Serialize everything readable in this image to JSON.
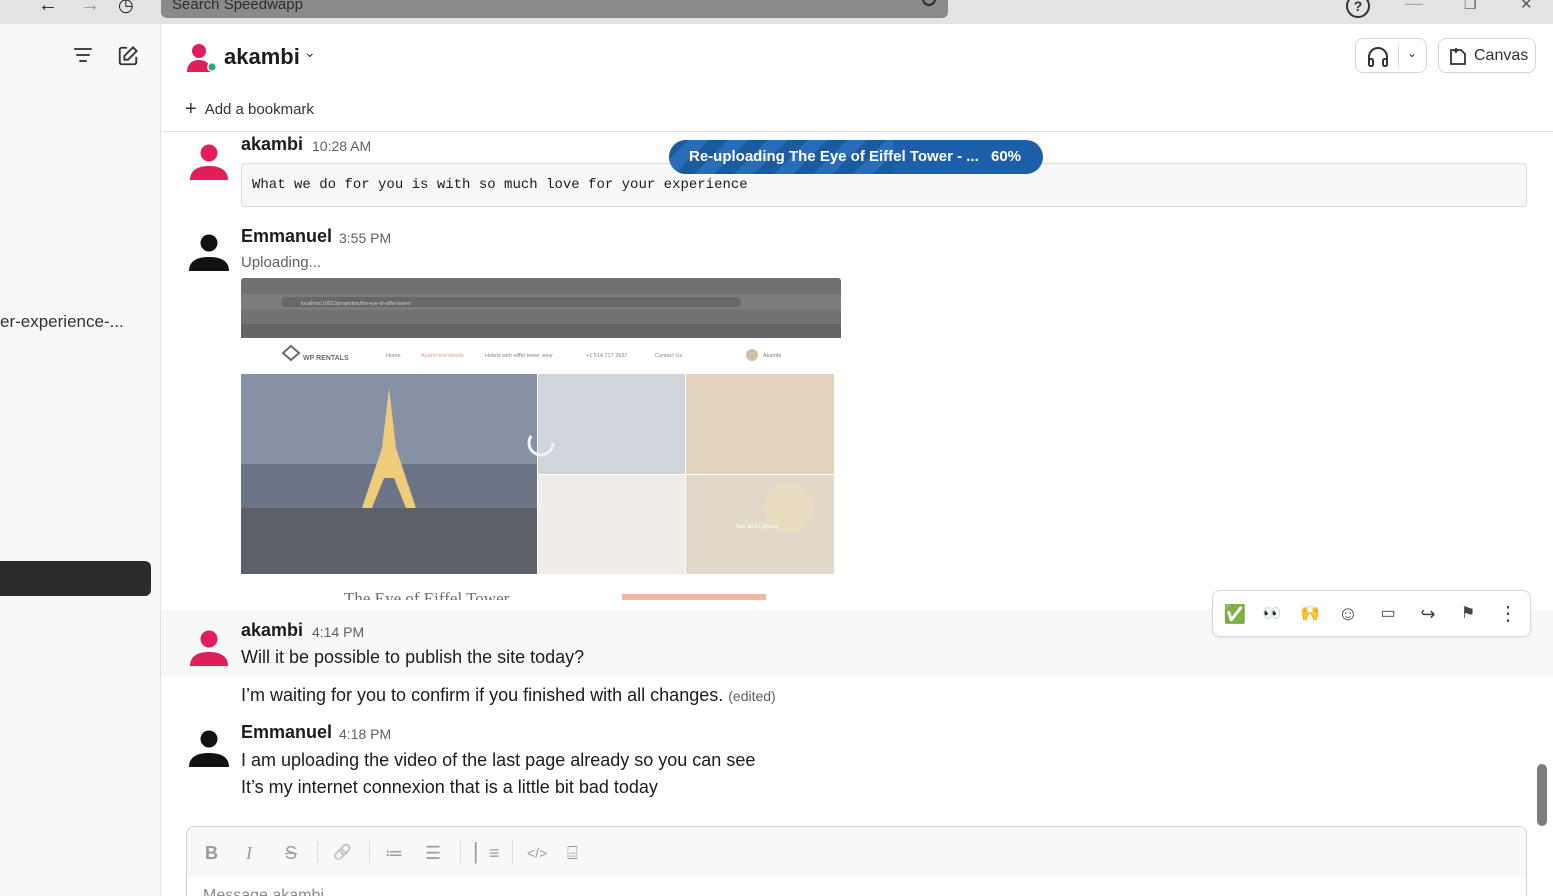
{
  "topbar": {
    "search_placeholder": "Search Speedwapp",
    "back_glyph": "←",
    "forward_glyph": "→",
    "history_glyph": "◷",
    "help_glyph": "?",
    "minimize_glyph": "—",
    "maximize_glyph": "❐",
    "close_glyph": "✕"
  },
  "sidebar": {
    "channel_fragment": "er-experience-..."
  },
  "header": {
    "title": "akambi",
    "chevron": "⌄",
    "huddle_chevron": "⌄",
    "canvas_label": "Canvas",
    "add_bookmark": "Add a bookmark",
    "plus": "+"
  },
  "upload_status": {
    "label": "Re-uploading The Eye of Eiffel Tower - ...",
    "percent": "60%",
    "progress_fraction": 0.6
  },
  "messages": [
    {
      "sender": "akambi",
      "time": "10:28 AM",
      "code": "What we do for you is with so much love for your experience"
    },
    {
      "sender": "Emmanuel",
      "time": "3:55 PM",
      "status": "Uploading...",
      "thumb_title": "The Eye of Eiffel Tower",
      "thumb_nav": [
        "Home",
        "Apartment details",
        "Hotels with eiffel tower view",
        "+1 514 717 2637",
        "Contact Us",
        "Akambi"
      ],
      "thumb_logo": "WP RENTALS",
      "thumb_see_all": "See all 12 photos",
      "thumb_url": "localhost:10022/properties/the-eye-of-eiffel-tower/"
    },
    {
      "sender": "akambi",
      "time": "4:14 PM",
      "text": "Will it be possible to publish the site today?"
    },
    {
      "text": "I’m waiting for you to confirm if you finished with all changes.",
      "edited": "(edited)"
    },
    {
      "sender": "Emmanuel",
      "time": "4:18 PM",
      "lines": [
        "I am uploading the video of the last page already so you can see",
        "It’s my internet connexion that is a little bit bad today"
      ]
    }
  ],
  "actions": {
    "check": "✅",
    "eyes": "👀",
    "raised_hands": "🙌",
    "add_reaction": "☺",
    "reply": "▭",
    "forward": "↪",
    "save": "⚑",
    "more": "⋮"
  },
  "composer": {
    "bold": "B",
    "italic": "I",
    "strike": "S",
    "link": "🔗",
    "ordered_list": "≔",
    "bulleted_list": "☰",
    "blockquote": "▏≡",
    "code": "</>",
    "code_block": "⌸",
    "placeholder": "Message akambi"
  }
}
